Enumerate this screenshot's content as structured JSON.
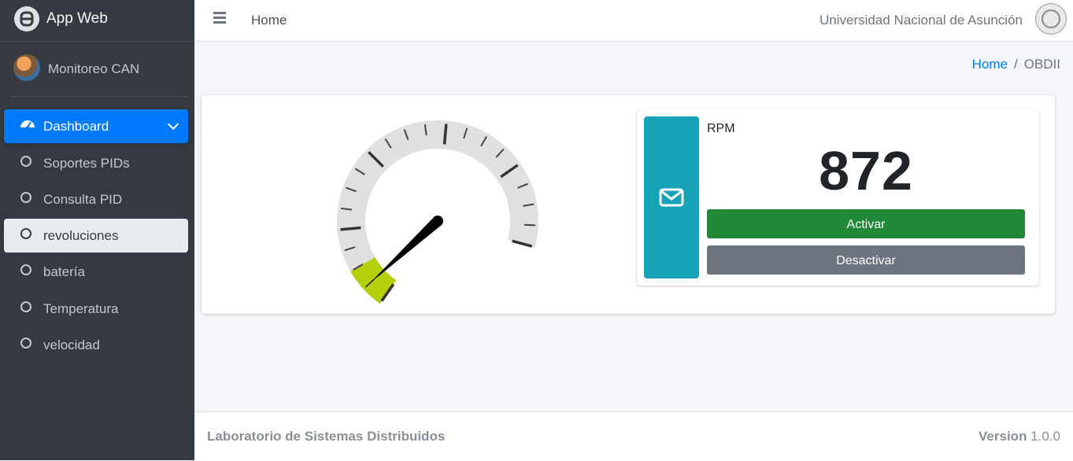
{
  "brand": {
    "title": "App Web"
  },
  "user": {
    "name": "Monitoreo CAN"
  },
  "sidebar": {
    "items": [
      {
        "label": "Dashboard"
      },
      {
        "label": "Soportes PIDs"
      },
      {
        "label": "Consulta PID"
      },
      {
        "label": "revoluciones"
      },
      {
        "label": "batería"
      },
      {
        "label": "Temperatura"
      },
      {
        "label": "velocidad"
      }
    ]
  },
  "navbar": {
    "home": "Home",
    "university": "Universidad Nacional de Asunción"
  },
  "breadcrumb": {
    "home": "Home",
    "separator": "/",
    "current": "OBDII"
  },
  "gauge": {
    "value_fraction": 0.05,
    "fill_color": "#b5cf0a",
    "track_color": "#e0e0e0"
  },
  "rpm": {
    "label": "RPM",
    "value": "872",
    "icon": "envelope-icon",
    "activate": "Activar",
    "deactivate": "Desactivar"
  },
  "colors": {
    "primary": "#007bff",
    "info": "#17a2b8",
    "success": "#218838",
    "secondary": "#6c757d",
    "sidebar": "#343a40"
  },
  "footer": {
    "left": "Laboratorio de Sistemas Distribuidos",
    "version_label": "Version",
    "version": "1.0.0"
  }
}
